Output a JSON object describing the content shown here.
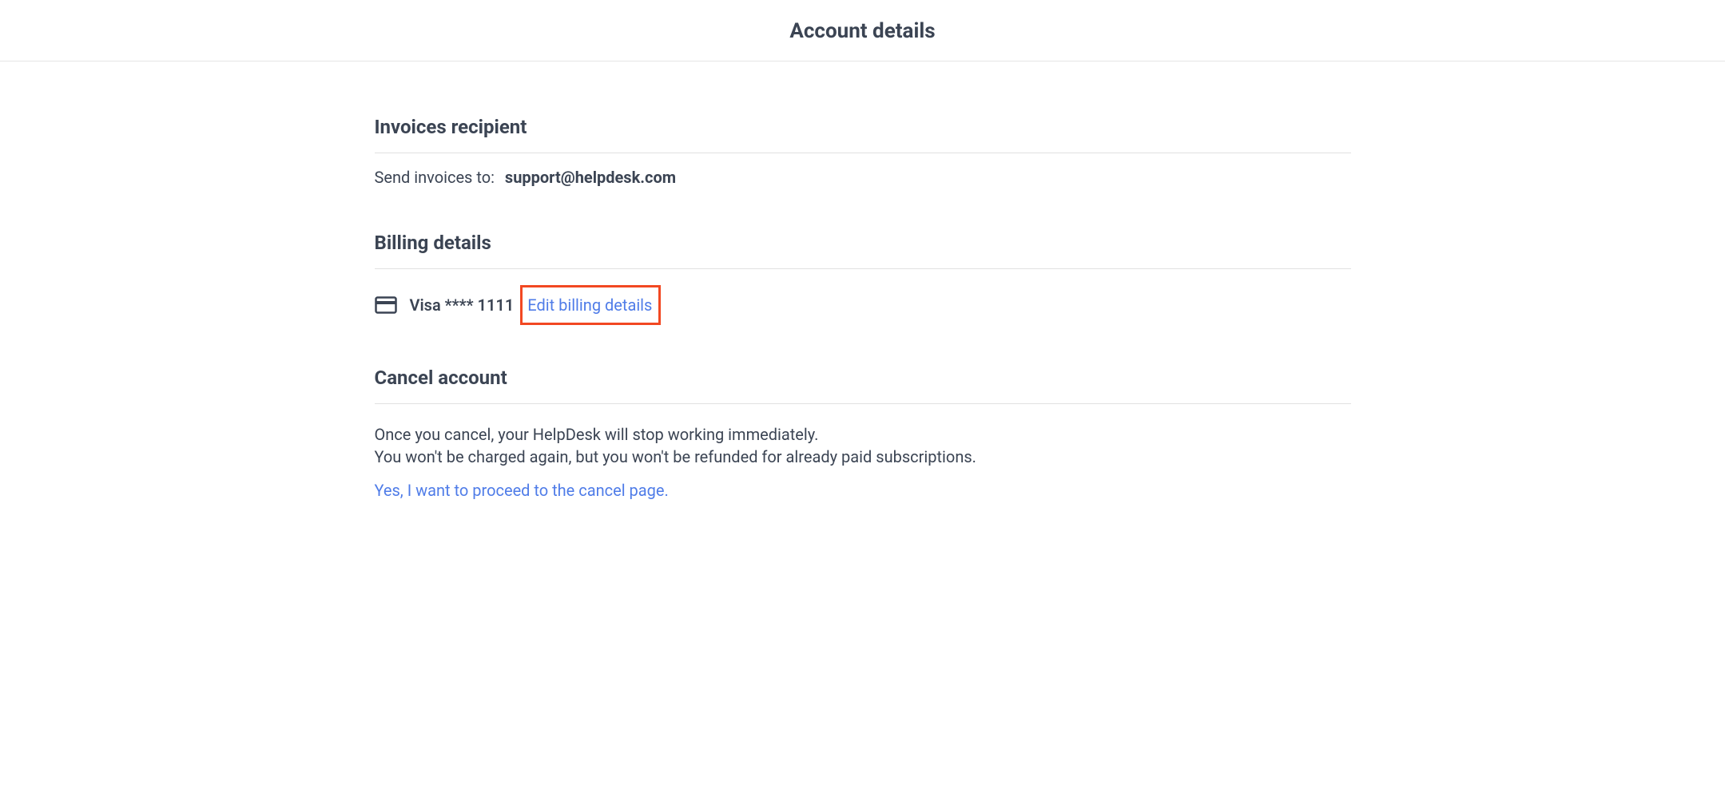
{
  "header": {
    "title": "Account details"
  },
  "invoices": {
    "section_title": "Invoices recipient",
    "label": "Send invoices to:",
    "email": "support@helpdesk.com"
  },
  "billing": {
    "section_title": "Billing details",
    "card_text": "Visa **** 1111",
    "edit_link": "Edit billing details"
  },
  "cancel": {
    "section_title": "Cancel account",
    "line1": "Once you cancel, your HelpDesk will stop working immediately.",
    "line2": "You won't be charged again, but you won't be refunded for already paid subscriptions.",
    "proceed_link": "Yes, I want to proceed to the cancel page."
  }
}
